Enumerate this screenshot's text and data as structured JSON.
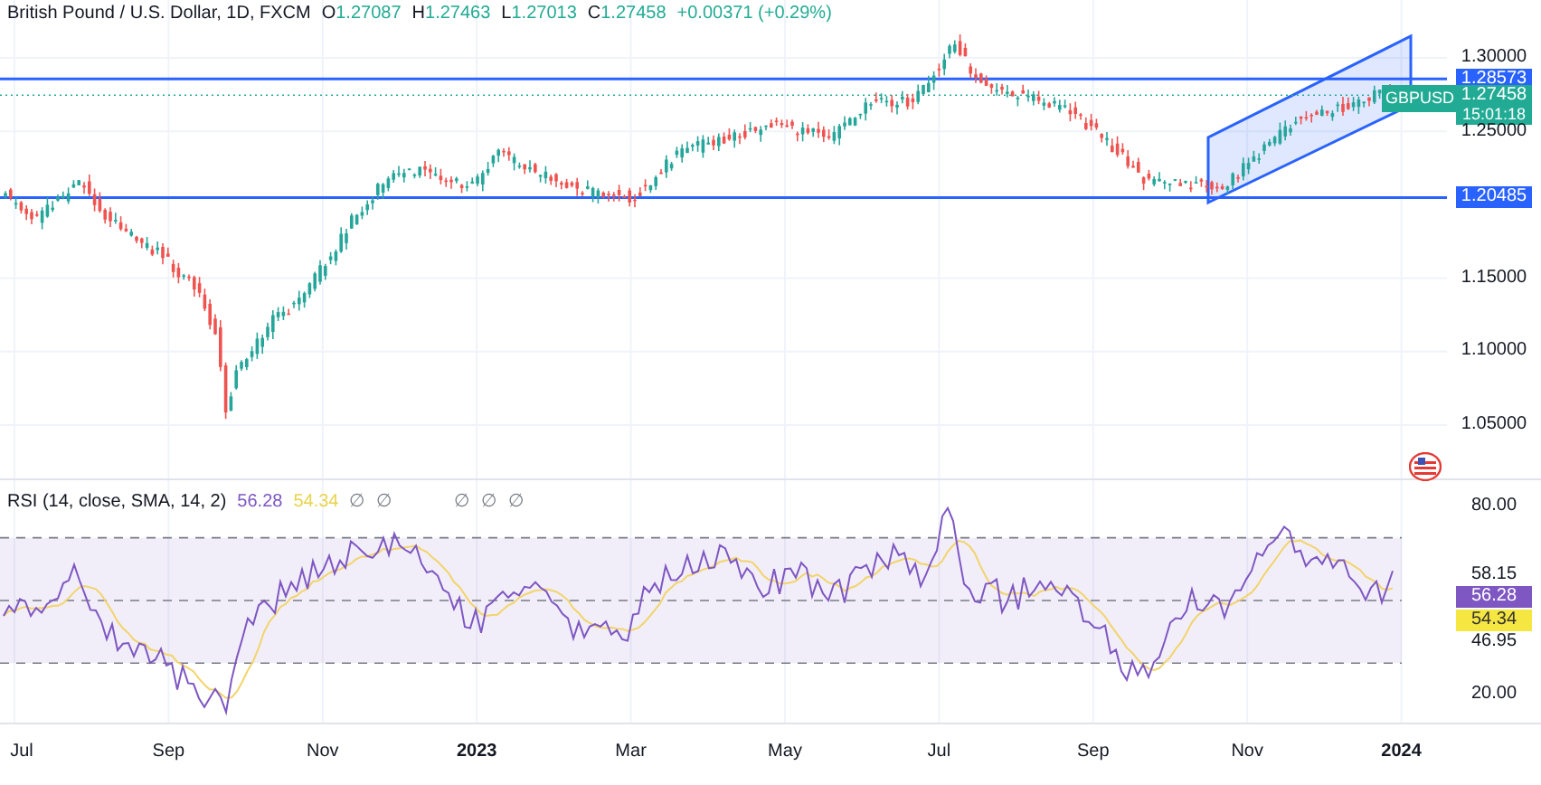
{
  "legend": {
    "title": "British Pound / U.S. Dollar, 1D, FXCM",
    "ohlc": [
      {
        "label": "O",
        "value": "1.27087"
      },
      {
        "label": "H",
        "value": "1.27463"
      },
      {
        "label": "L",
        "value": "1.27013"
      },
      {
        "label": "C",
        "value": "1.27458"
      }
    ],
    "change": "+0.00371 (+0.29%)"
  },
  "symbol_tag": "GBPUSD",
  "price_axis": [
    {
      "kind": "tick",
      "value": "1.30000"
    },
    {
      "kind": "line",
      "value": "1.28573"
    },
    {
      "kind": "price",
      "value": "1.27458",
      "countdown": "15:01:18"
    },
    {
      "kind": "tick",
      "value": "1.25000"
    },
    {
      "kind": "line",
      "value": "1.20485"
    },
    {
      "kind": "tick",
      "value": "1.15000"
    },
    {
      "kind": "tick",
      "value": "1.10000"
    },
    {
      "kind": "tick",
      "value": "1.05000"
    }
  ],
  "rsi": {
    "title": "RSI (14, close, SMA, 14, 2)",
    "rsi_value": "56.28",
    "sma_value": "54.34",
    "markers": [
      "∅",
      "∅",
      "∅",
      "∅",
      "∅"
    ]
  },
  "rsi_axis": [
    {
      "kind": "tick",
      "value": "80.00"
    },
    {
      "kind": "tick",
      "value": "58.15"
    },
    {
      "kind": "rsi",
      "value": "56.28"
    },
    {
      "kind": "sma",
      "value": "54.34"
    },
    {
      "kind": "tick",
      "value": "46.95"
    },
    {
      "kind": "tick",
      "value": "20.00"
    }
  ],
  "time_axis": [
    {
      "label": "Jul",
      "kind": "month"
    },
    {
      "label": "Sep",
      "kind": "month"
    },
    {
      "label": "Nov",
      "kind": "month"
    },
    {
      "label": "2023",
      "kind": "year"
    },
    {
      "label": "Mar",
      "kind": "month"
    },
    {
      "label": "May",
      "kind": "month"
    },
    {
      "label": "Jul",
      "kind": "month"
    },
    {
      "label": "Sep",
      "kind": "month"
    },
    {
      "label": "Nov",
      "kind": "month"
    },
    {
      "label": "2024",
      "kind": "year"
    }
  ]
}
